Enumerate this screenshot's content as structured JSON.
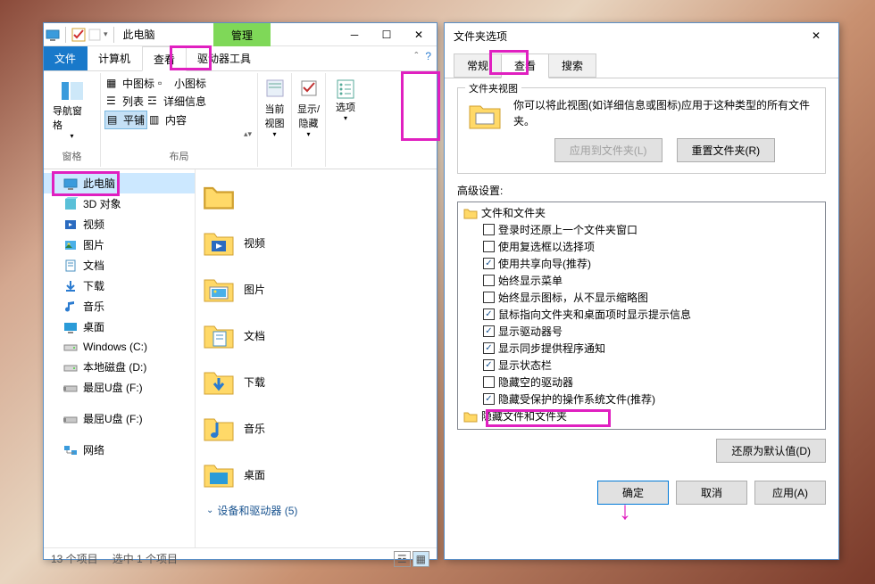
{
  "explorer": {
    "title": "此电脑",
    "manage": "管理",
    "tabs": {
      "file": "文件",
      "computer": "计算机",
      "view": "查看",
      "driveTools": "驱动器工具"
    },
    "ribbon": {
      "navPane": "导航窗格",
      "panes": "窗格",
      "mediumIcons": "中图标",
      "smallIcons": "小图标",
      "list": "列表",
      "details": "详细信息",
      "tiles": "平铺",
      "content": "内容",
      "layout": "布局",
      "currentView": "当前视图",
      "showHide": "显示/隐藏",
      "options": "选项"
    },
    "tree": [
      {
        "label": "此电脑",
        "icon": "pc",
        "selected": true
      },
      {
        "label": "3D 对象",
        "icon": "3d"
      },
      {
        "label": "视频",
        "icon": "video"
      },
      {
        "label": "图片",
        "icon": "picture"
      },
      {
        "label": "文档",
        "icon": "document"
      },
      {
        "label": "下载",
        "icon": "download"
      },
      {
        "label": "音乐",
        "icon": "music"
      },
      {
        "label": "桌面",
        "icon": "desktop"
      },
      {
        "label": "Windows (C:)",
        "icon": "drive"
      },
      {
        "label": "本地磁盘 (D:)",
        "icon": "drive"
      },
      {
        "label": "最屈U盘 (F:)",
        "icon": "usb"
      },
      {
        "label": "最屈U盘 (F:)",
        "icon": "usb"
      },
      {
        "label": "网络",
        "icon": "network"
      }
    ],
    "folders": [
      {
        "label": "视频",
        "icon": "video"
      },
      {
        "label": "图片",
        "icon": "picture"
      },
      {
        "label": "文档",
        "icon": "document"
      },
      {
        "label": "下载",
        "icon": "download"
      },
      {
        "label": "音乐",
        "icon": "music"
      },
      {
        "label": "桌面",
        "icon": "desktop"
      }
    ],
    "devicesHeader": "设备和驱动器 (5)",
    "status": {
      "count": "13 个项目",
      "selected": "选中 1 个项目"
    }
  },
  "dialog": {
    "title": "文件夹选项",
    "tabs": {
      "general": "常规",
      "view": "查看",
      "search": "搜索"
    },
    "folderView": {
      "title": "文件夹视图",
      "desc": "你可以将此视图(如详细信息或图标)应用于这种类型的所有文件夹。",
      "applyBtn": "应用到文件夹(L)",
      "resetBtn": "重置文件夹(R)"
    },
    "advancedLabel": "高级设置:",
    "settings": [
      {
        "label": "文件和文件夹",
        "root": true,
        "checked": null
      },
      {
        "label": "登录时还原上一个文件夹窗口",
        "checked": false
      },
      {
        "label": "使用复选框以选择项",
        "checked": false
      },
      {
        "label": "使用共享向导(推荐)",
        "checked": true
      },
      {
        "label": "始终显示菜单",
        "checked": false
      },
      {
        "label": "始终显示图标，从不显示缩略图",
        "checked": false
      },
      {
        "label": "鼠标指向文件夹和桌面项时显示提示信息",
        "checked": true
      },
      {
        "label": "显示驱动器号",
        "checked": true
      },
      {
        "label": "显示同步提供程序通知",
        "checked": true
      },
      {
        "label": "显示状态栏",
        "checked": true
      },
      {
        "label": "隐藏空的驱动器",
        "checked": false,
        "highlight": true
      },
      {
        "label": "隐藏受保护的操作系统文件(推荐)",
        "checked": true
      },
      {
        "label": "隐藏文件和文件夹",
        "root": true,
        "checked": null,
        "iconOnly": true
      }
    ],
    "restoreDefaults": "还原为默认值(D)",
    "buttons": {
      "ok": "确定",
      "cancel": "取消",
      "apply": "应用(A)"
    }
  }
}
